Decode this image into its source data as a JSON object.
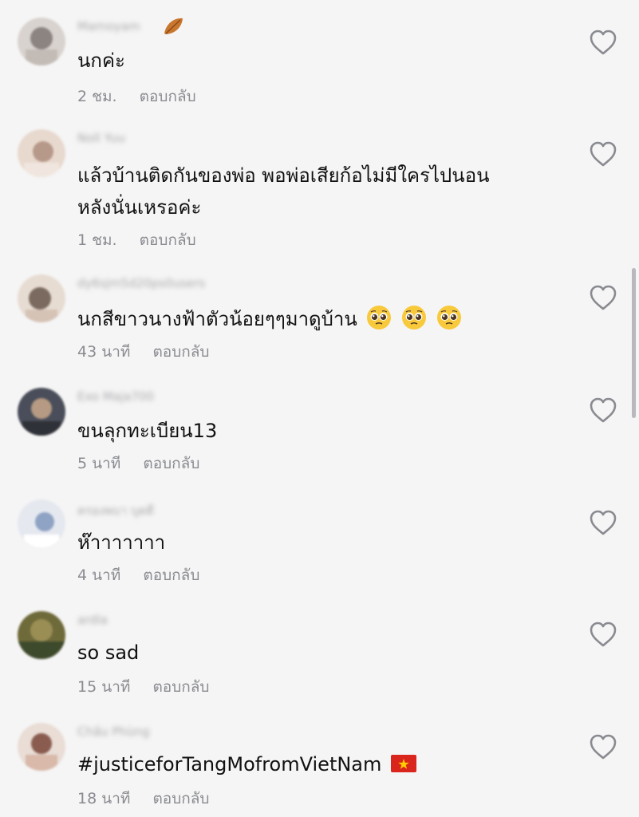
{
  "comments": [
    {
      "username": "Mamoyam",
      "text_lines": [
        "นกค่ะ"
      ],
      "time": "2 ชม.",
      "reply": "ตอบกลับ",
      "avatar_colors": [
        "#d9d3cf",
        "#8c8480",
        "#c3bcb6"
      ]
    },
    {
      "username": "Noll Yuu",
      "text_lines": [
        "แล้วบ้านติดกันของพ่อ พอพ่อเสียก้อไม่มีใครไปนอน",
        "หลังนั่นเหรอค่ะ"
      ],
      "time": "1 ชม.",
      "reply": "ตอบกลับ",
      "avatar_colors": [
        "#e8d9cf",
        "#b7998a",
        "#f0e6df"
      ]
    },
    {
      "username": "dy6sjm5d20ps0users",
      "text_lines": [
        "นกสีขาวนางฟ้าตัวน้อยๆๆมาดูบ้าน"
      ],
      "emojis": [
        "pleading-face-icon",
        "pleading-face-icon",
        "pleading-face-icon"
      ],
      "time": "43 นาที",
      "reply": "ตอบกลับ",
      "avatar_colors": [
        "#e7dcd2",
        "#7b6a5f",
        "#d5c3b6"
      ]
    },
    {
      "username": "Exo Maja700",
      "text_lines": [
        "ขนลุกทะเบียน13"
      ],
      "time": "5 นาที",
      "reply": "ตอบกลับ",
      "avatar_colors": [
        "#4a4e5a",
        "#b69a83",
        "#2f3138"
      ]
    },
    {
      "username": "ครองพบา บุตดี",
      "text_lines": [
        "ห๊าาาาาาา"
      ],
      "time": "4 นาที",
      "reply": "ตอบกลับ",
      "avatar_colors": [
        "#e5e8ef",
        "#8fa3c4",
        "#ffffff"
      ]
    },
    {
      "username": "ardla",
      "text_lines": [
        "so sad"
      ],
      "time": "15 นาที",
      "reply": "ตอบกลับ",
      "avatar_colors": [
        "#6f6a3a",
        "#3e4a2c",
        "#9a8e55"
      ]
    },
    {
      "username": "Chầu Phùng",
      "text_lines": [
        "#justiceforTangMofromVietNam"
      ],
      "flag": "vietnam-flag-icon",
      "time": "18 นาที",
      "reply": "ตอบกลับ",
      "avatar_colors": [
        "#e9ddd6",
        "#8a5c4f",
        "#d8b9aa"
      ]
    }
  ],
  "colors": {
    "background": "#f5f5f5",
    "text": "#111111",
    "meta": "#8a8b91",
    "heart_outline": "#8a8b91"
  }
}
